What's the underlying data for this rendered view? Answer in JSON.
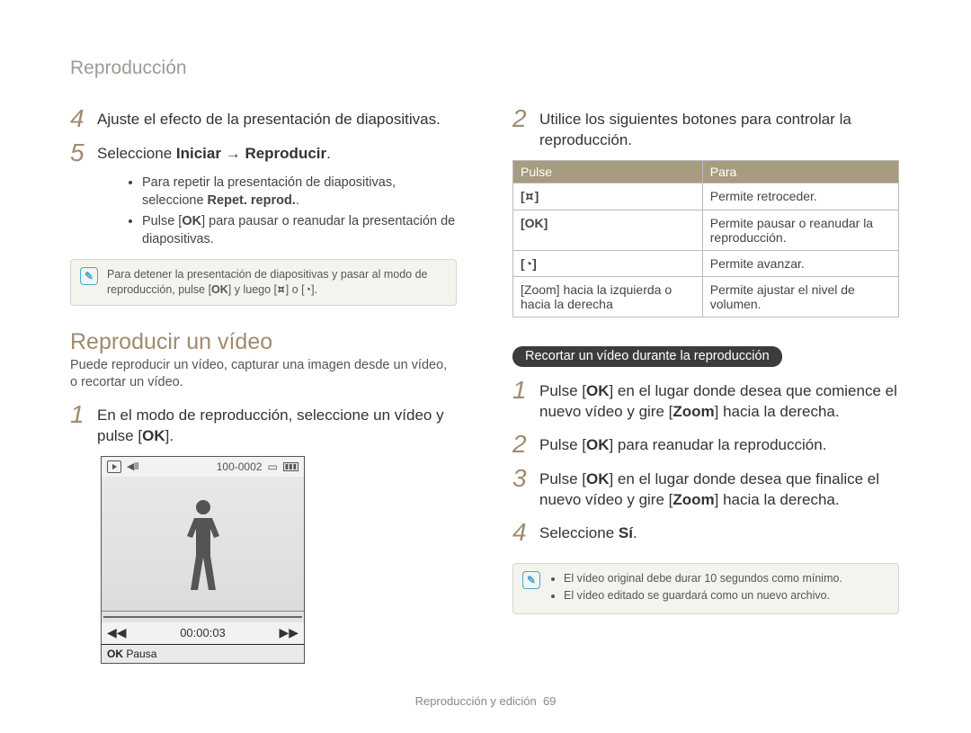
{
  "header": "Reproducción",
  "left": {
    "step4": {
      "n": "4",
      "text": "Ajuste el efecto de la presentación de diapositivas."
    },
    "step5": {
      "n": "5",
      "pre": "Seleccione ",
      "b1": "Iniciar",
      "arrow": " → ",
      "b2": "Reproducir",
      "post": "."
    },
    "bullets": {
      "b1a": "Para repetir la presentación de diapositivas, seleccione ",
      "b1b": "Repet. reprod.",
      "b1c": ".",
      "b2a": "Pulse [",
      "b2ok": "OK",
      "b2b": "] para pausar o reanudar la presentación de diapositivas."
    },
    "note1": {
      "a": "Para detener la presentación de diapositivas y pasar al modo de reproducción, pulse [",
      "ok": "OK",
      "b": "] y luego [",
      "flash": "⯏",
      "c": "] o [",
      "timer": "◔",
      "d": "]."
    },
    "h2": "Reproducir un vídeo",
    "sub": "Puede reproducir un vídeo, capturar una imagen desde un vídeo, o recortar un vídeo.",
    "step1": {
      "n": "1",
      "a": "En el modo de reproducción, seleccione un vídeo y pulse [",
      "ok": "OK",
      "b": "]."
    },
    "cam": {
      "counter": "100-0002",
      "time": "00:00:03",
      "pause": "Pausa",
      "ok": "OK",
      "sound": "◀Ⅱ",
      "batt": "▮▮▮"
    }
  },
  "right": {
    "step2": {
      "n": "2",
      "text": "Utilice los siguientes botones para controlar la reproducción."
    },
    "table": {
      "h1": "Pulse",
      "h2": "Para",
      "r1c1": "[⯏]",
      "r1c2": "Permite retroceder.",
      "r2c1": "[OK]",
      "r2c2": "Permite pausar o reanudar la reproducción.",
      "r3c1": "[◔]",
      "r3c2": "Permite avanzar.",
      "r4c1a": "[Zoom]",
      "r4c1b": " hacia la izquierda o hacia la derecha",
      "r4c2": "Permite ajustar el nivel de volumen."
    },
    "pill": "Recortar un vídeo durante la reproducción",
    "t1": {
      "n": "1",
      "a": "Pulse [",
      "ok": "OK",
      "b": "] en el lugar donde desea que comience el nuevo vídeo y gire [",
      "z": "Zoom",
      "c": "] hacia la derecha."
    },
    "t2": {
      "n": "2",
      "a": "Pulse [",
      "ok": "OK",
      "b": "] para reanudar la reproducción."
    },
    "t3": {
      "n": "3",
      "a": "Pulse [",
      "ok": "OK",
      "b": "] en el lugar donde desea que finalice el nuevo vídeo y gire [",
      "z": "Zoom",
      "c": "] hacia la derecha."
    },
    "t4": {
      "n": "4",
      "a": "Seleccione ",
      "b": "Sí",
      "c": "."
    },
    "note2": {
      "a": "El vídeo original debe durar 10 segundos como mínimo.",
      "b": "El vídeo editado se guardará como un nuevo archivo."
    }
  },
  "footer": {
    "text": "Reproducción y edición",
    "page": "69"
  }
}
